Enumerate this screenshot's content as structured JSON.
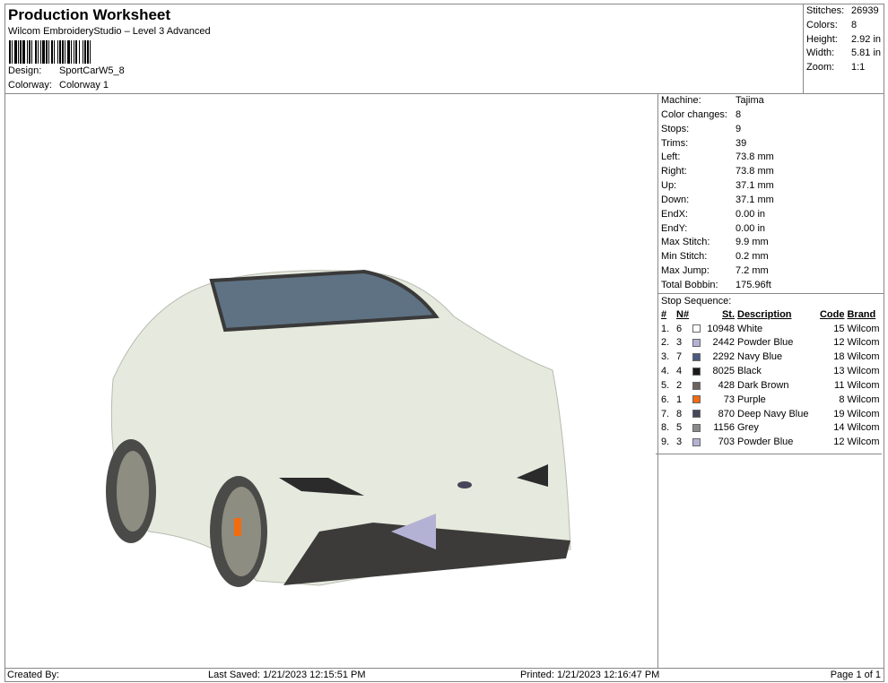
{
  "header": {
    "title": "Production Worksheet",
    "subtitle": "Wilcom EmbroideryStudio – Level 3 Advanced",
    "design_label": "Design:",
    "design": "SportCarW5_8",
    "colorway_label": "Colorway:",
    "colorway": "Colorway 1"
  },
  "stats": [
    {
      "label": "Stitches:",
      "value": "26939"
    },
    {
      "label": "Colors:",
      "value": "8"
    },
    {
      "label": "Height:",
      "value": "2.92 in"
    },
    {
      "label": "Width:",
      "value": "5.81 in"
    },
    {
      "label": "Zoom:",
      "value": "1:1"
    }
  ],
  "info": [
    {
      "label": "Machine:",
      "value": "Tajima"
    },
    {
      "label": "Color changes:",
      "value": "8"
    },
    {
      "label": "Stops:",
      "value": "9"
    },
    {
      "label": "Trims:",
      "value": "39"
    },
    {
      "label": "Left:",
      "value": "73.8 mm"
    },
    {
      "label": "Right:",
      "value": "73.8 mm"
    },
    {
      "label": "Up:",
      "value": "37.1 mm"
    },
    {
      "label": "Down:",
      "value": "37.1 mm"
    },
    {
      "label": "EndX:",
      "value": "0.00 in"
    },
    {
      "label": "EndY:",
      "value": "0.00 in"
    },
    {
      "label": "Max Stitch:",
      "value": "9.9 mm"
    },
    {
      "label": "Min Stitch:",
      "value": "0.2 mm"
    },
    {
      "label": "Max Jump:",
      "value": "7.2 mm"
    },
    {
      "label": "Total Bobbin:",
      "value": "175.96ft"
    }
  ],
  "sequence": {
    "title": "Stop Sequence:",
    "headers": {
      "num": "#",
      "n": "N#",
      "st": "St.",
      "desc": "Description",
      "code": "Code",
      "brand": "Brand"
    },
    "rows": [
      {
        "num": "1.",
        "n": "6",
        "color": "#ffffff",
        "st": "10948",
        "desc": "White",
        "code": "15",
        "brand": "Wilcom"
      },
      {
        "num": "2.",
        "n": "3",
        "color": "#b4b2d4",
        "st": "2442",
        "desc": "Powder Blue",
        "code": "12",
        "brand": "Wilcom"
      },
      {
        "num": "3.",
        "n": "7",
        "color": "#4c5a80",
        "st": "2292",
        "desc": "Navy Blue",
        "code": "18",
        "brand": "Wilcom"
      },
      {
        "num": "4.",
        "n": "4",
        "color": "#1a1a1a",
        "st": "8025",
        "desc": "Black",
        "code": "13",
        "brand": "Wilcom"
      },
      {
        "num": "5.",
        "n": "2",
        "color": "#6e625e",
        "st": "428",
        "desc": "Dark Brown",
        "code": "11",
        "brand": "Wilcom"
      },
      {
        "num": "6.",
        "n": "1",
        "color": "#f26b0f",
        "st": "73",
        "desc": "Purple",
        "code": "8",
        "brand": "Wilcom"
      },
      {
        "num": "7.",
        "n": "8",
        "color": "#45465a",
        "st": "870",
        "desc": "Deep Navy Blue",
        "code": "19",
        "brand": "Wilcom"
      },
      {
        "num": "8.",
        "n": "5",
        "color": "#8a8a8a",
        "st": "1156",
        "desc": "Grey",
        "code": "14",
        "brand": "Wilcom"
      },
      {
        "num": "9.",
        "n": "3",
        "color": "#b4b2d4",
        "st": "703",
        "desc": "Powder Blue",
        "code": "12",
        "brand": "Wilcom"
      }
    ]
  },
  "footer": {
    "created": "Created By:",
    "saved": "Last Saved: 1/21/2023 12:15:51 PM",
    "printed": "Printed: 1/21/2023 12:16:47 PM",
    "page": "Page 1 of 1"
  }
}
